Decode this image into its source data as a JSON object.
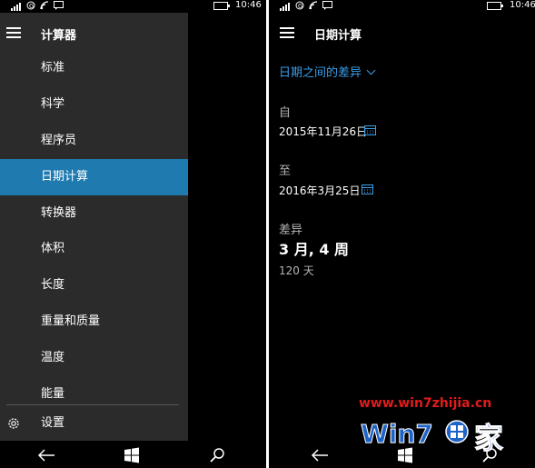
{
  "left_screen": {
    "status": {
      "time": "10:46"
    },
    "drawer": {
      "title": "计算器",
      "items": [
        {
          "label": "标准"
        },
        {
          "label": "科学"
        },
        {
          "label": "程序员"
        },
        {
          "label": "日期计算",
          "active": true
        },
        {
          "label": "转换器"
        },
        {
          "label": "体积"
        },
        {
          "label": "长度"
        },
        {
          "label": "重量和质量"
        },
        {
          "label": "温度"
        },
        {
          "label": "能量"
        }
      ],
      "settings_label": "设置"
    }
  },
  "right_screen": {
    "status": {
      "time": "10:46"
    },
    "title": "日期计算",
    "mode": "日期之间的差异",
    "from_label": "自",
    "from_date": "2015年11月26日",
    "to_label": "至",
    "to_date": "2016年3月25日",
    "difference_label": "差异",
    "difference_main": "3 月, 4 周",
    "difference_days": "120 天"
  },
  "colors": {
    "accent": "#1f7ab0",
    "link": "#3a9ee8",
    "drawer_bg": "#2b2b2b",
    "watermark": "#e21b1b"
  },
  "watermark": {
    "url": "www.win7zhijia.cn",
    "logo_text": "Win7之家"
  },
  "nav_icons": [
    "back-arrow-icon",
    "windows-logo-icon",
    "search-icon"
  ]
}
